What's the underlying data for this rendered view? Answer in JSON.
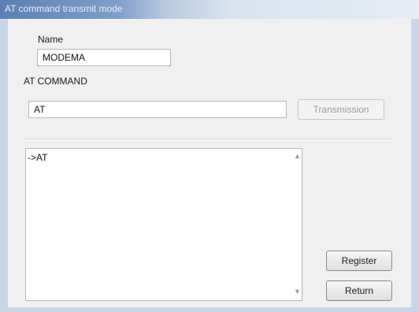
{
  "window": {
    "title": "AT command transmit mode"
  },
  "name_field": {
    "label": "Name",
    "value": "MODEMA"
  },
  "at_command": {
    "label": "AT COMMAND",
    "value": "AT",
    "transmit_label": "Transmission"
  },
  "log": {
    "lines": [
      "->AT"
    ]
  },
  "buttons": {
    "register_label": "Register",
    "return_label": "Return"
  },
  "icons": {
    "scroll_up": "scroll-up-arrow",
    "scroll_down": "scroll-down-arrow"
  }
}
